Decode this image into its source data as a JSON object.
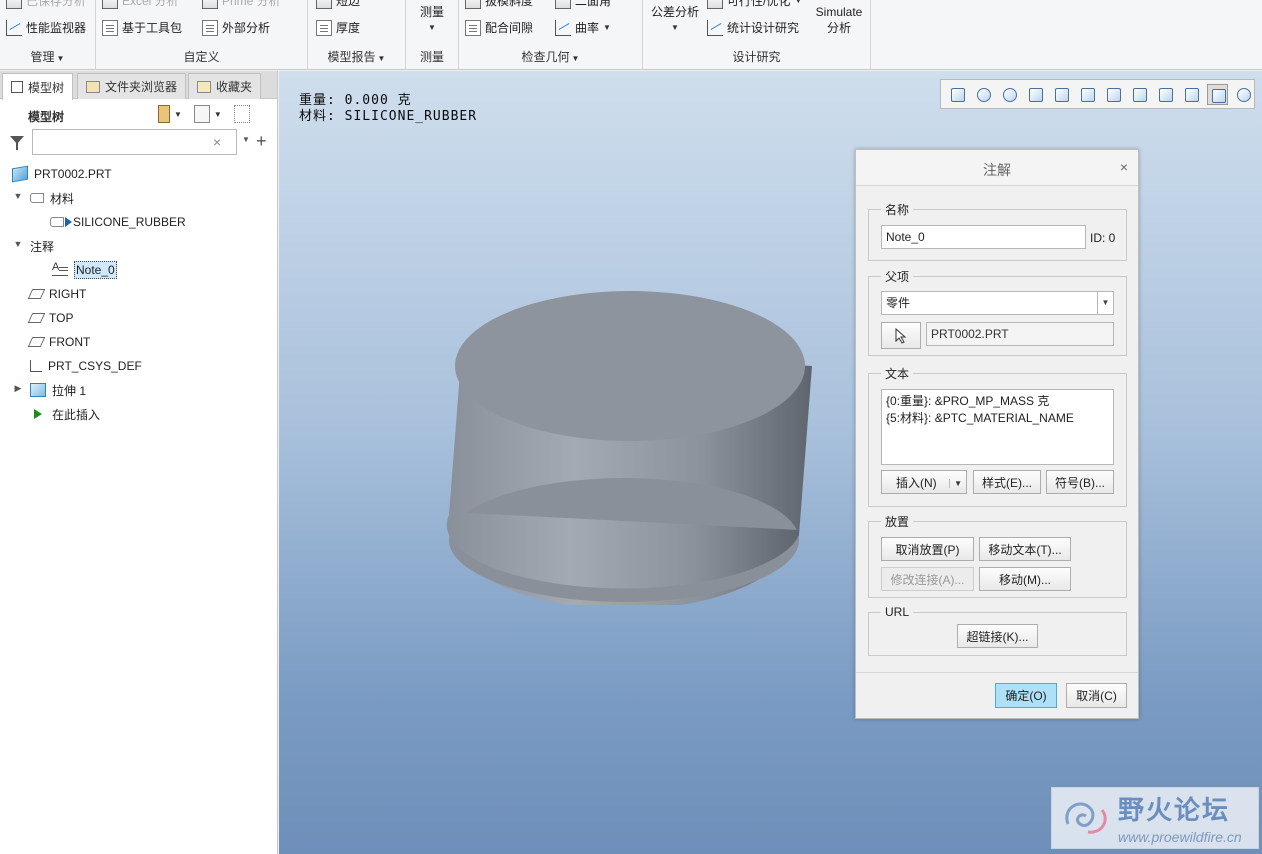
{
  "ribbon": {
    "groups": [
      {
        "label": "管理",
        "buttons": [
          "已保存分析",
          "性能监视器"
        ]
      },
      {
        "label": "自定义",
        "buttons": [
          "Excel 分析",
          "基于工具包",
          "Prime 分析",
          "外部分析"
        ]
      },
      {
        "label": "模型报告",
        "buttons": [
          "短边",
          "厚度"
        ]
      },
      {
        "label": "测量",
        "buttons": [
          "测量"
        ]
      },
      {
        "label": "检查几何",
        "buttons": [
          "拔模斜度",
          "配合间隙",
          "二面角",
          "曲率"
        ]
      },
      {
        "label": "设计研究",
        "buttons": [
          "公差分析",
          "可行性/优化",
          "统计设计研究",
          "Simulate",
          "分析"
        ]
      }
    ]
  },
  "left_panel": {
    "tabs": [
      "模型树",
      "文件夹浏览器",
      "收藏夹"
    ],
    "tree_title": "模型树",
    "filter_placeholder": "",
    "tree": [
      {
        "label": "PRT0002.PRT"
      },
      {
        "label": "材料"
      },
      {
        "label": "SILICONE_RUBBER"
      },
      {
        "label": "注释"
      },
      {
        "label": "Note_0"
      },
      {
        "label": "RIGHT"
      },
      {
        "label": "TOP"
      },
      {
        "label": "FRONT"
      },
      {
        "label": "PRT_CSYS_DEF"
      },
      {
        "label": "拉伸 1"
      },
      {
        "label": "在此插入"
      }
    ]
  },
  "viewport": {
    "annotation_line1": "重量: 0.000 克",
    "annotation_line2": "材料: SILICONE_RUBBER",
    "model_colors": {
      "top": "#8e949e",
      "side_light": "#a3aab3",
      "side_dark": "#5f656e"
    }
  },
  "dialog": {
    "title": "注解",
    "name_section": {
      "legend": "名称",
      "value": "Note_0",
      "id_text": "ID: 0"
    },
    "parent_section": {
      "legend": "父项",
      "type": "零件",
      "reference": "PRT0002.PRT"
    },
    "text_section": {
      "legend": "文本",
      "line1": "{0:重量}: &PRO_MP_MASS 克",
      "line2": "{5:材料}: &PTC_MATERIAL_NAME",
      "insert_label": "插入(N)",
      "style_label": "样式(E)...",
      "symbol_label": "符号(B)..."
    },
    "placement_section": {
      "legend": "放置",
      "unplace_label": "取消放置(P)",
      "move_text_label": "移动文本(T)...",
      "modify_attach_label": "修改连接(A)...",
      "move_label": "移动(M)..."
    },
    "url_section": {
      "legend": "URL",
      "hyperlink_label": "超链接(K)..."
    },
    "ok_label": "确定(O)",
    "cancel_label": "取消(C)"
  },
  "watermark": {
    "title": "野火论坛",
    "url": "www.proewildfire.cn"
  }
}
